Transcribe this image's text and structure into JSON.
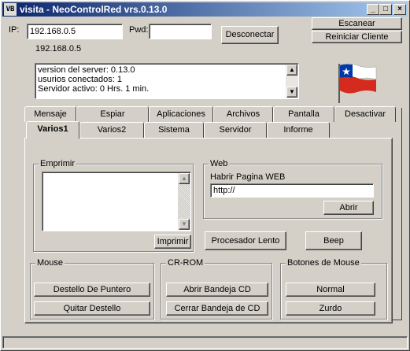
{
  "window": {
    "app_icon": "VB",
    "title": "visita - NeoControlRed vrs.0.13.0",
    "minimize": "_",
    "maximize": "□",
    "close": "×"
  },
  "connection": {
    "ip_label": "IP:",
    "ip_value": "192.168.0.5",
    "pwd_label": "Pwd:",
    "pwd_value": "",
    "disconnect_label": "Desconectar",
    "scan_label": "Escanear",
    "restart_label": "Reiniciar Cliente",
    "current_ip": "192.168.0.5"
  },
  "server_info": {
    "lines": [
      "version del server: 0.13.0",
      "usurios conectados: 1",
      "Servidor activo: 0 Hrs. 1 min."
    ]
  },
  "flag": {
    "icon": "chile-flag-icon",
    "colors": {
      "blue": "#0039a6",
      "red": "#d52b1e",
      "white": "#ffffff"
    }
  },
  "tabs_row1": [
    "Mensaje",
    "Espiar",
    "Aplicaciones",
    "Archivos",
    "Pantalla",
    "Desactivar"
  ],
  "tabs_row2": [
    "Varios1",
    "Varios2",
    "Sistema",
    "Servidor",
    "Informe"
  ],
  "active_tab": "Varios1",
  "print_group": {
    "title": "Emprimir",
    "text": "",
    "print_button": "Imprimir"
  },
  "web_group": {
    "title": "Web",
    "label": "Habrir Pagina WEB",
    "url": "http://",
    "open_button": "Abrir"
  },
  "slow_button": "Procesador Lento",
  "beep_button": "Beep",
  "mouse_group": {
    "title": "Mouse",
    "flash_button": "Destello De Puntero",
    "remove_flash_button": "Quitar Destello"
  },
  "cdrom_group": {
    "title": "CR-ROM",
    "open_tray_button": "Abrir Bandeja CD",
    "close_tray_button": "Cerrar Bandeja de CD"
  },
  "mouse_buttons_group": {
    "title": "Botones de Mouse",
    "normal_button": "Normal",
    "left_button": "Zurdo"
  }
}
